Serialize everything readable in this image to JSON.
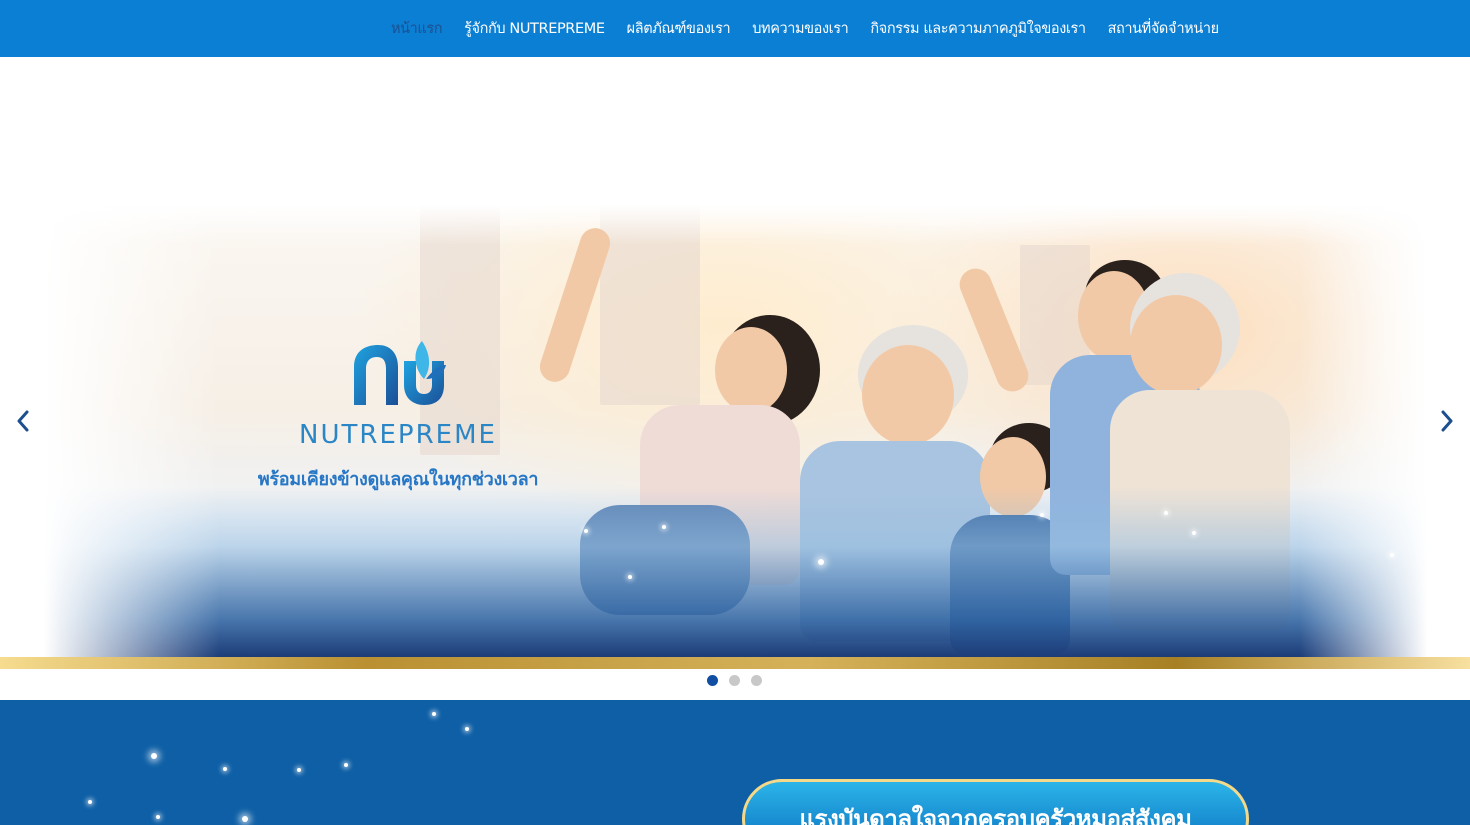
{
  "nav": {
    "items": [
      {
        "label": "หน้าแรก",
        "active": true
      },
      {
        "label": "รู้จักกับ NUTREPREME",
        "active": false
      },
      {
        "label": "ผลิตภัณฑ์ของเรา",
        "active": false
      },
      {
        "label": "บทความของเรา",
        "active": false
      },
      {
        "label": "กิจกรรม และความภาคภูมิใจของเรา",
        "active": false
      },
      {
        "label": "สถานที่จัดจำหน่าย",
        "active": false
      }
    ],
    "background_color": "#0b7fd3",
    "active_color": "#1d4f8f"
  },
  "hero": {
    "brand": "NUTREPREME",
    "tagline": "พร้อมเคียงข้างดูแลคุณในทุกช่วงเวลา",
    "logo_icon": "nutrepreme-logo-icon",
    "prev_icon": "chevron-left-icon",
    "next_icon": "chevron-right-icon",
    "slides_count": 3,
    "active_slide": 1
  },
  "section2": {
    "banner_text": "แรงบันดาลใจจากครอบครัวหมอสู่สังคม",
    "background_color": "#0e5fa6"
  }
}
